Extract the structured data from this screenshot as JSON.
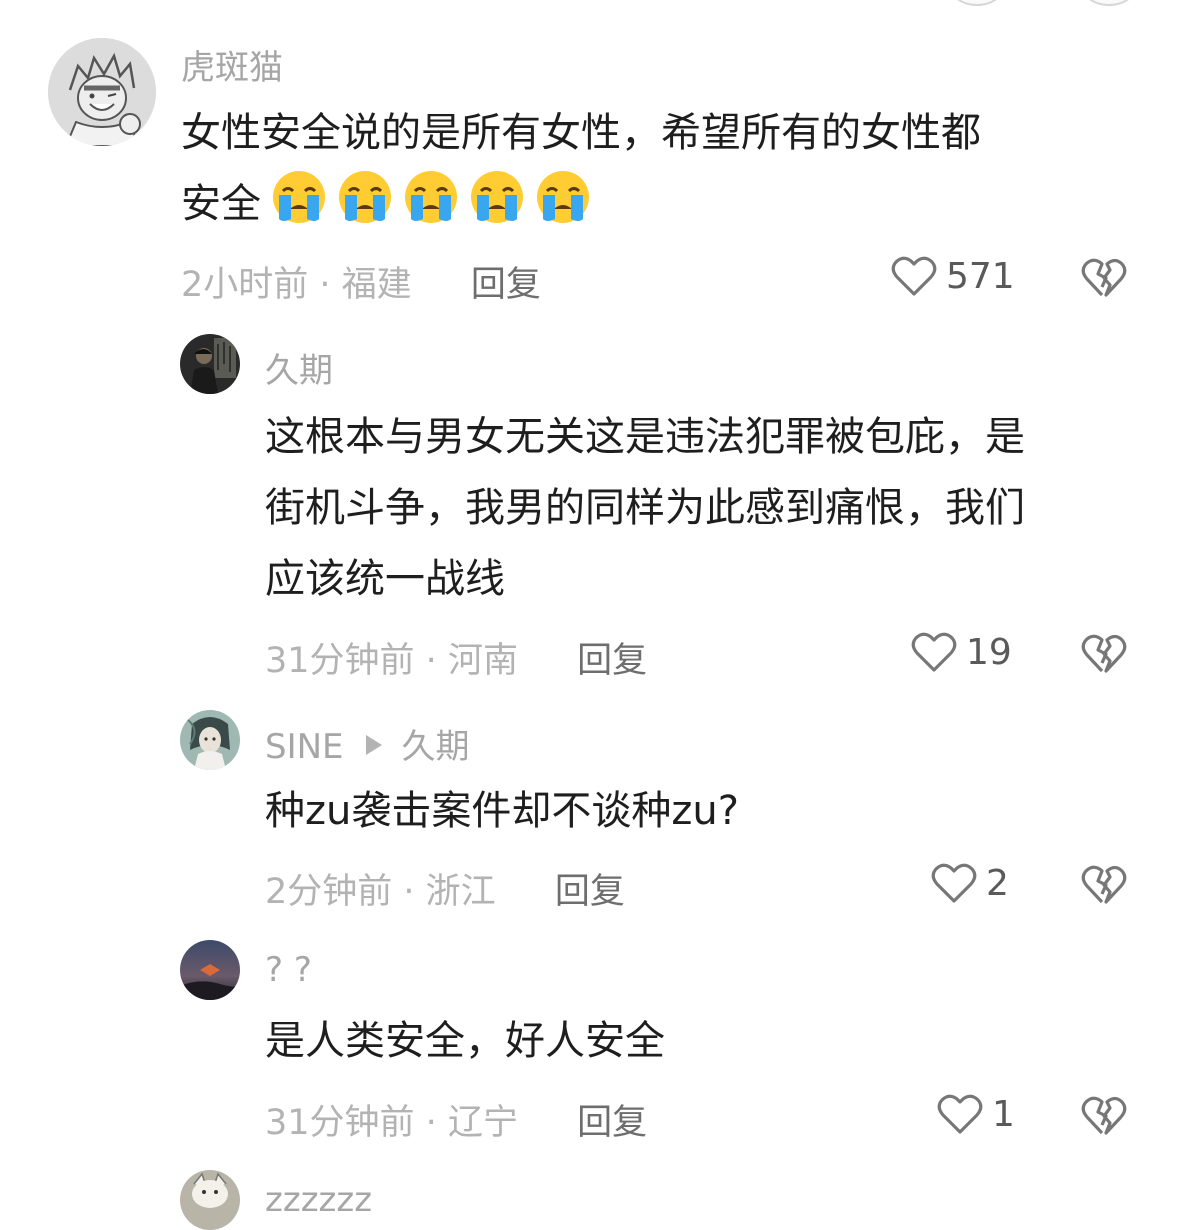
{
  "comments": [
    {
      "username": "虎斑猫",
      "text_lines": [
        "女性安全说的是所有女性，希望所有的女性都",
        "安全"
      ],
      "emojis": [
        "crying-emoji",
        "crying-emoji",
        "crying-emoji",
        "crying-emoji",
        "crying-emoji"
      ],
      "time": "2小时前",
      "location": "福建",
      "reply_label": "回复",
      "likes": "571",
      "avatar": "anime-sketch-avatar"
    },
    {
      "username": "久期",
      "text_lines": [
        "这根本与男女无关这是违法犯罪被包庇，是",
        "街机斗争，我男的同样为此感到痛恨，我们",
        "应该统一战线"
      ],
      "time": "31分钟前",
      "location": "河南",
      "reply_label": "回复",
      "likes": "19",
      "avatar": "dark-portrait-avatar"
    },
    {
      "username": "SINE",
      "reply_to": "久期",
      "text_lines": [
        "种zu袭击案件却不谈种zu?"
      ],
      "time": "2分钟前",
      "location": "浙江",
      "reply_label": "回复",
      "likes": "2",
      "avatar": "illustrated-character-avatar"
    },
    {
      "username": "? ?",
      "text_lines": [
        "是人类安全，好人安全"
      ],
      "time": "31分钟前",
      "location": "辽宁",
      "reply_label": "回复",
      "likes": "1",
      "avatar": "dusk-sky-avatar"
    }
  ],
  "next_comment": {
    "username": "zzzzzz",
    "avatar": "cat-avatar"
  },
  "meta_separator": " · ",
  "colors": {
    "text": "#1e1e1e",
    "username": "#a6a6a6",
    "meta": "#b3b3b3",
    "reply": "#6e6e6e",
    "icon": "#777777",
    "emoji_face": "#ffcc33",
    "emoji_tear": "#39a7f0"
  }
}
